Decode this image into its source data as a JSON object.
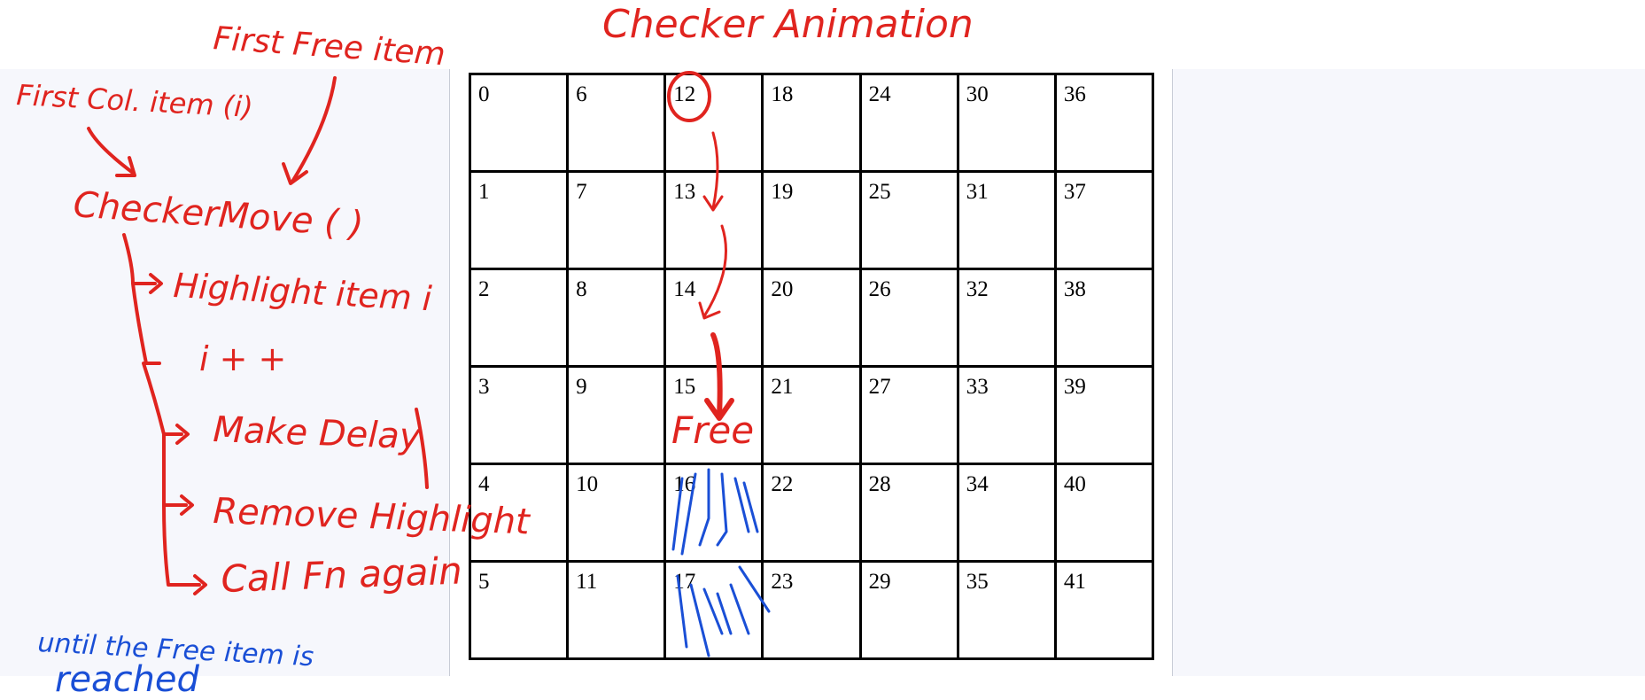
{
  "grid": {
    "rows": [
      [
        "0",
        "6",
        "12",
        "18",
        "24",
        "30",
        "36"
      ],
      [
        "1",
        "7",
        "13",
        "19",
        "25",
        "31",
        "37"
      ],
      [
        "2",
        "8",
        "14",
        "20",
        "26",
        "32",
        "38"
      ],
      [
        "3",
        "9",
        "15",
        "21",
        "27",
        "33",
        "39"
      ],
      [
        "4",
        "10",
        "16",
        "22",
        "28",
        "34",
        "40"
      ],
      [
        "5",
        "11",
        "17",
        "23",
        "29",
        "35",
        "41"
      ]
    ]
  },
  "annotations": {
    "title": "Checker Animation",
    "first_free_item": "First Free item",
    "first_col_item": "First Col. item (i)",
    "function_name": "CheckerMove ( )",
    "step_highlight": "Highlight item i",
    "step_increment": "i + +",
    "step_delay": "Make Delay",
    "step_remove": "Remove Highlight",
    "step_call": "Call Fn again",
    "free_label": "Free",
    "until_text_1": "until the Free item is",
    "until_text_2": "reached"
  },
  "colors": {
    "ink_red": "#e0241f",
    "ink_blue": "#1a4fd6",
    "panel_bg": "#f6f7fc"
  }
}
